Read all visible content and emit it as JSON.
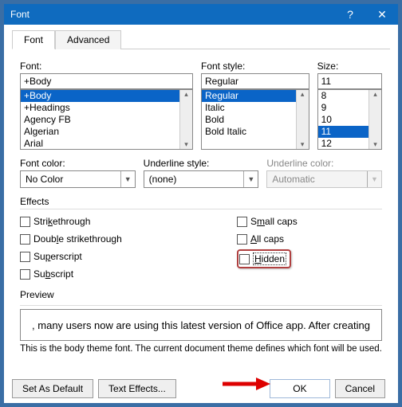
{
  "window": {
    "title": "Font",
    "help": "?",
    "close": "✕"
  },
  "tabs": {
    "font": "Font",
    "advanced": "Advanced"
  },
  "font": {
    "label": "Font:",
    "value": "+Body",
    "list": [
      "+Body",
      "+Headings",
      "Agency FB",
      "Algerian",
      "Arial"
    ],
    "selected": 0
  },
  "style": {
    "label": "Font style:",
    "value": "Regular",
    "list": [
      "Regular",
      "Italic",
      "Bold",
      "Bold Italic"
    ],
    "selected": 0
  },
  "size": {
    "label": "Size:",
    "value": "11",
    "list": [
      "8",
      "9",
      "10",
      "11",
      "12"
    ],
    "selected": 3
  },
  "color": {
    "label": "Font color:",
    "value": "No Color"
  },
  "uline": {
    "label": "Underline style:",
    "value": "(none)"
  },
  "ucolor": {
    "label": "Underline color:",
    "value": "Automatic"
  },
  "effects": {
    "label": "Effects",
    "strike": "Strikethrough",
    "dstrike": "Double strikethrough",
    "sup": "Superscript",
    "sub": "Subscript",
    "scaps": "Small caps",
    "acaps": "All caps",
    "hidden": "Hidden"
  },
  "preview": {
    "label": "Preview",
    "text": ", many users now are using this latest version of Office app. After creating",
    "note": "This is the body theme font. The current document theme defines which font will be used."
  },
  "buttons": {
    "setdefault": "Set As Default",
    "texteffects": "Text Effects...",
    "ok": "OK",
    "cancel": "Cancel"
  }
}
